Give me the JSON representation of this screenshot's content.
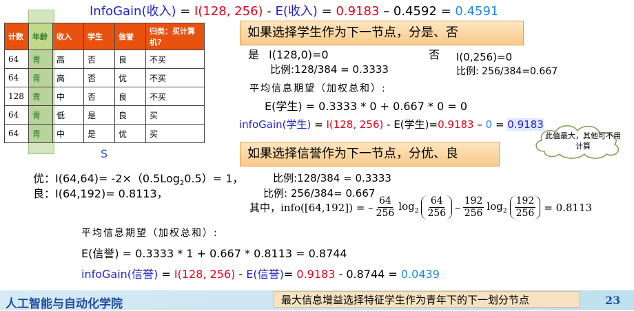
{
  "top_formula": {
    "lhs": "InfoGain(收入)",
    "eq1": " = ",
    "I": "I(128, 256)",
    "minus": " - ",
    "E": "E(收入)",
    "eq2": " = ",
    "v1": "0.9183",
    "op": " – 0.4592 = ",
    "result": "0.4591"
  },
  "table": {
    "headers": [
      "计数",
      "年龄",
      "收入",
      "学生",
      "信誉",
      "归类：买计算机?"
    ],
    "rows": [
      [
        "64",
        "青",
        "高",
        "否",
        "良",
        "不买"
      ],
      [
        "64",
        "青",
        "高",
        "否",
        "优",
        "不买"
      ],
      [
        "128",
        "青",
        "中",
        "否",
        "良",
        "不买"
      ],
      [
        "64",
        "青",
        "低",
        "是",
        "良",
        "买"
      ],
      [
        "64",
        "青",
        "中",
        "是",
        "优",
        "买"
      ]
    ],
    "label": "S"
  },
  "student": {
    "callout": "如果选择学生作为下一节点，分是、否",
    "yes_label": "是",
    "yes_info": "I(128,0)=0",
    "yes_ratio": "比例:128/384 = 0.3333",
    "no_label": "否",
    "no_info": "I(0,256)=0",
    "no_ratio": "比例: 256/384=0.667",
    "avg_title": "平均信息期望（加权总和）:",
    "expectation": "E(学生) = 0.3333 * 0 + 0.667 * 0 = 0",
    "gain_lhs": "infoGain(学生)",
    "gain_eq": " = ",
    "gain_I": "I(128, 256)",
    "gain_minus": " - ",
    "gain_E": "E(学生)",
    "gain_eq2": "=",
    "gain_v1": "0.9183",
    "gain_op": " – ",
    "gain_v2": "0",
    "gain_eq3": " = ",
    "gain_result": "0.9183"
  },
  "cloud_note": "此值最大，其他可不用计算",
  "credit": {
    "callout": "如果选择信誉作为下一节点，分优、良",
    "good_line": "优：I(64,64)= -2×（0.5Log",
    "good_sub": "2",
    "good_line2": "0.5）= 1，",
    "good_ratio": "比例:128/384 = 0.3333",
    "fair_line": "良：I(64,192)= 0.8113，",
    "fair_ratio": "比例: 256/384= 0.667",
    "info_prefix": "其中，info([64,192]) = –",
    "n64": "64",
    "n256": "256",
    "n192": "192",
    "log": "log",
    "log_base": "2",
    "info_result": "= 0.8113",
    "avg_title": "平均信息期望（加权总和）:",
    "expectation": "E(信誉) = 0.3333 * 1 + 0.667 * 0.8113 = 0.8744",
    "gain_lhs": "infoGain(信誉)",
    "gain_eq": " = ",
    "gain_I": "I(128, 256)",
    "gain_minus": " - ",
    "gain_E": "E(信誉)",
    "gain_eq2": "= ",
    "gain_v1": "0.9183",
    "gain_op": " - 0.8744 = ",
    "gain_result": "0.0439"
  },
  "footer": {
    "school": "人工智能与自动化学院",
    "note": "最大信息增益选择特征学生作为青年下的下一划分节点",
    "page": "23"
  },
  "colors": {
    "table_header": "#e8520e",
    "age_column": "#b9d39a",
    "callout": "#f9c98a",
    "formula_blue": "#2222cc",
    "formula_red": "#e0001a",
    "result_blue": "#1e88e5",
    "footer": "#bfe0ec"
  }
}
